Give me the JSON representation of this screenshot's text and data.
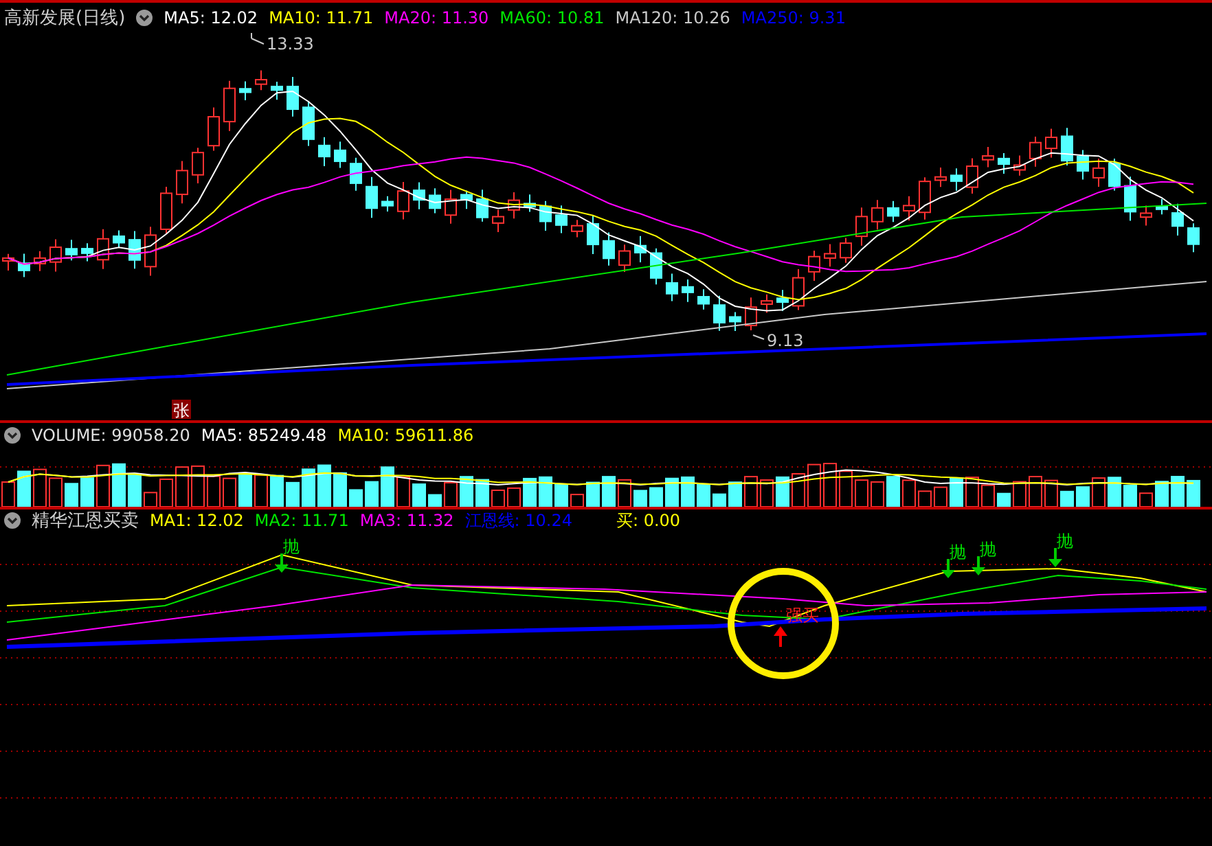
{
  "main": {
    "title": "高新发展(日线)",
    "indicators": [
      {
        "label": "MA5: 12.02",
        "color": "#ffffff"
      },
      {
        "label": "MA10: 11.71",
        "color": "#ffff00"
      },
      {
        "label": "MA20: 11.30",
        "color": "#ff00ff"
      },
      {
        "label": "MA60: 10.81",
        "color": "#00e600"
      },
      {
        "label": "MA120: 10.26",
        "color": "#c8c8c8"
      },
      {
        "label": "MA250: 9.31",
        "color": "#0000ff"
      }
    ],
    "high_label": "13.33",
    "low_label": "9.13",
    "badge": "张"
  },
  "volume": {
    "title": "VOLUME: 99058.20",
    "indicators": [
      {
        "label": "MA5: 85249.48",
        "color": "#ffffff"
      },
      {
        "label": "MA10: 59611.86",
        "color": "#ffff00"
      }
    ]
  },
  "indicator": {
    "title": "精华江恩买卖",
    "indicators": [
      {
        "label": "MA1: 12.02",
        "color": "#ffff00"
      },
      {
        "label": "MA2: 11.71",
        "color": "#00e600"
      },
      {
        "label": "MA3: 11.32",
        "color": "#ff00ff"
      },
      {
        "label": "江恩线: 10.24",
        "color": "#0000ff"
      },
      {
        "label": "买: 0.00",
        "color": "#ffff00"
      }
    ],
    "signals": [
      {
        "label": "抛",
        "kind": "sell"
      },
      {
        "label": "抛",
        "kind": "sell"
      },
      {
        "label": "抛",
        "kind": "sell"
      },
      {
        "label": "抛",
        "kind": "sell"
      },
      {
        "label": "强买",
        "kind": "buy"
      }
    ]
  }
}
